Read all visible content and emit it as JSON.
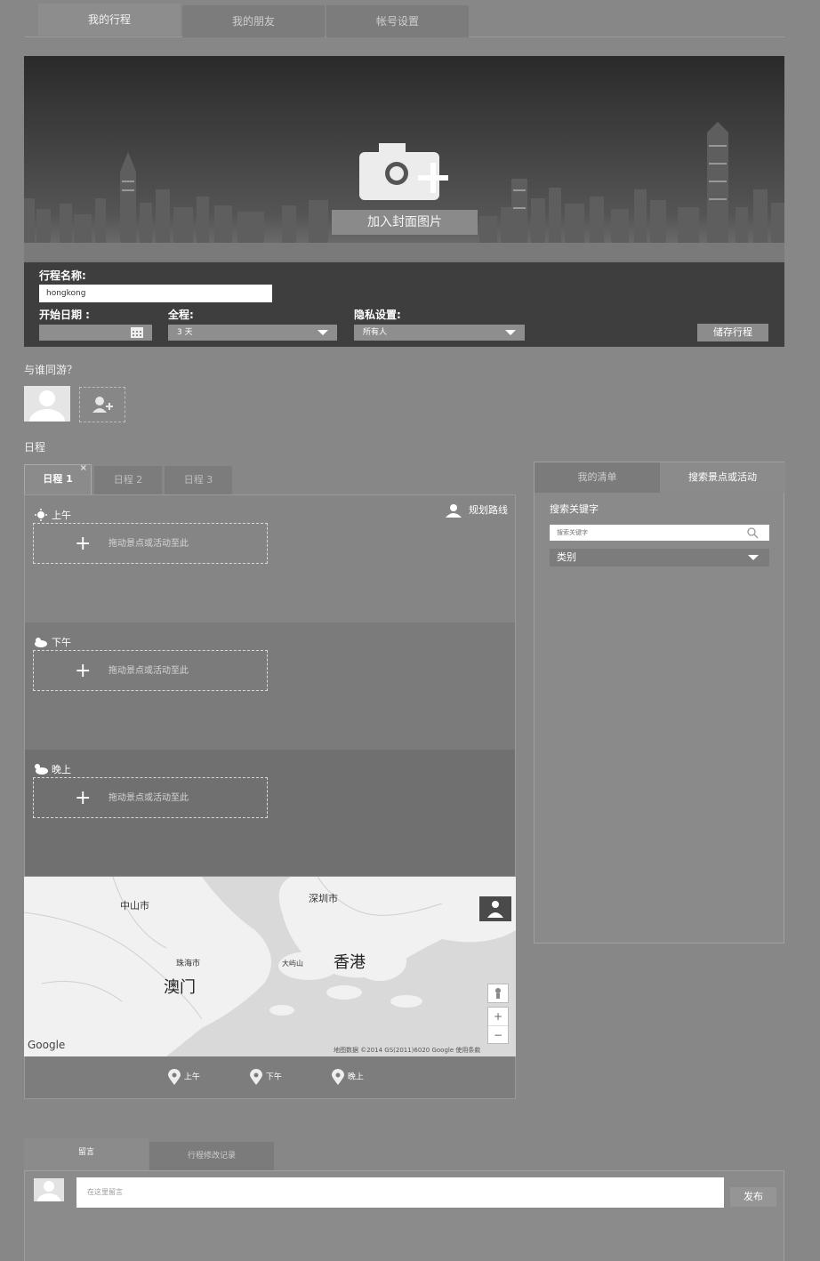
{
  "top_tabs": [
    {
      "label": "我的行程"
    },
    {
      "label": "我的朋友"
    },
    {
      "label": "帐号设置"
    }
  ],
  "hero": {
    "cover_button": "加入封面图片",
    "name_label": "行程名称:",
    "name_value": "hongkong",
    "start_label": "开始日期 :",
    "duration_label": "全程:",
    "duration_value": "3 天",
    "privacy_label": "隐私设置:",
    "privacy_value": "所有人",
    "save_button": "储存行程"
  },
  "companions": {
    "label": "与谁同游？"
  },
  "schedule": {
    "label": "日程",
    "tabs": [
      {
        "label": "日程 1"
      },
      {
        "label": "日程 2"
      },
      {
        "label": "日程 3"
      }
    ],
    "close_glyph": "×",
    "route_label": "规划路线",
    "periods": [
      {
        "label": "上午",
        "placeholder": "拖动景点或活动至此"
      },
      {
        "label": "下午",
        "placeholder": "拖动景点或活动至此"
      },
      {
        "label": "晚上",
        "placeholder": "拖动景点或活动至此"
      }
    ],
    "plus_glyph": "+"
  },
  "map": {
    "labels": {
      "zhongshan": "中山市",
      "shenzhen": "深圳市",
      "hongkong": "香港",
      "macau": "澳门",
      "zhuhai": "珠海市",
      "dayu": "大屿山"
    },
    "google": "Google",
    "copyright": "地图数据 ©2014 GS(2011)6020 Google  使用条款",
    "zoom_in": "+",
    "zoom_out": "−",
    "legend": [
      {
        "label": "上午"
      },
      {
        "label": "下午"
      },
      {
        "label": "晚上"
      }
    ]
  },
  "right_panel": {
    "tabs": [
      {
        "label": "我的清单"
      },
      {
        "label": "搜索景点或活动"
      }
    ],
    "keyword_label": "搜索关键字",
    "search_placeholder": "搜索关键字",
    "category_value": "类别"
  },
  "comments": {
    "tabs": [
      {
        "label": "留言"
      },
      {
        "label": "行程修改记录"
      }
    ],
    "input_placeholder": "在这里留言",
    "post_button": "发布"
  }
}
